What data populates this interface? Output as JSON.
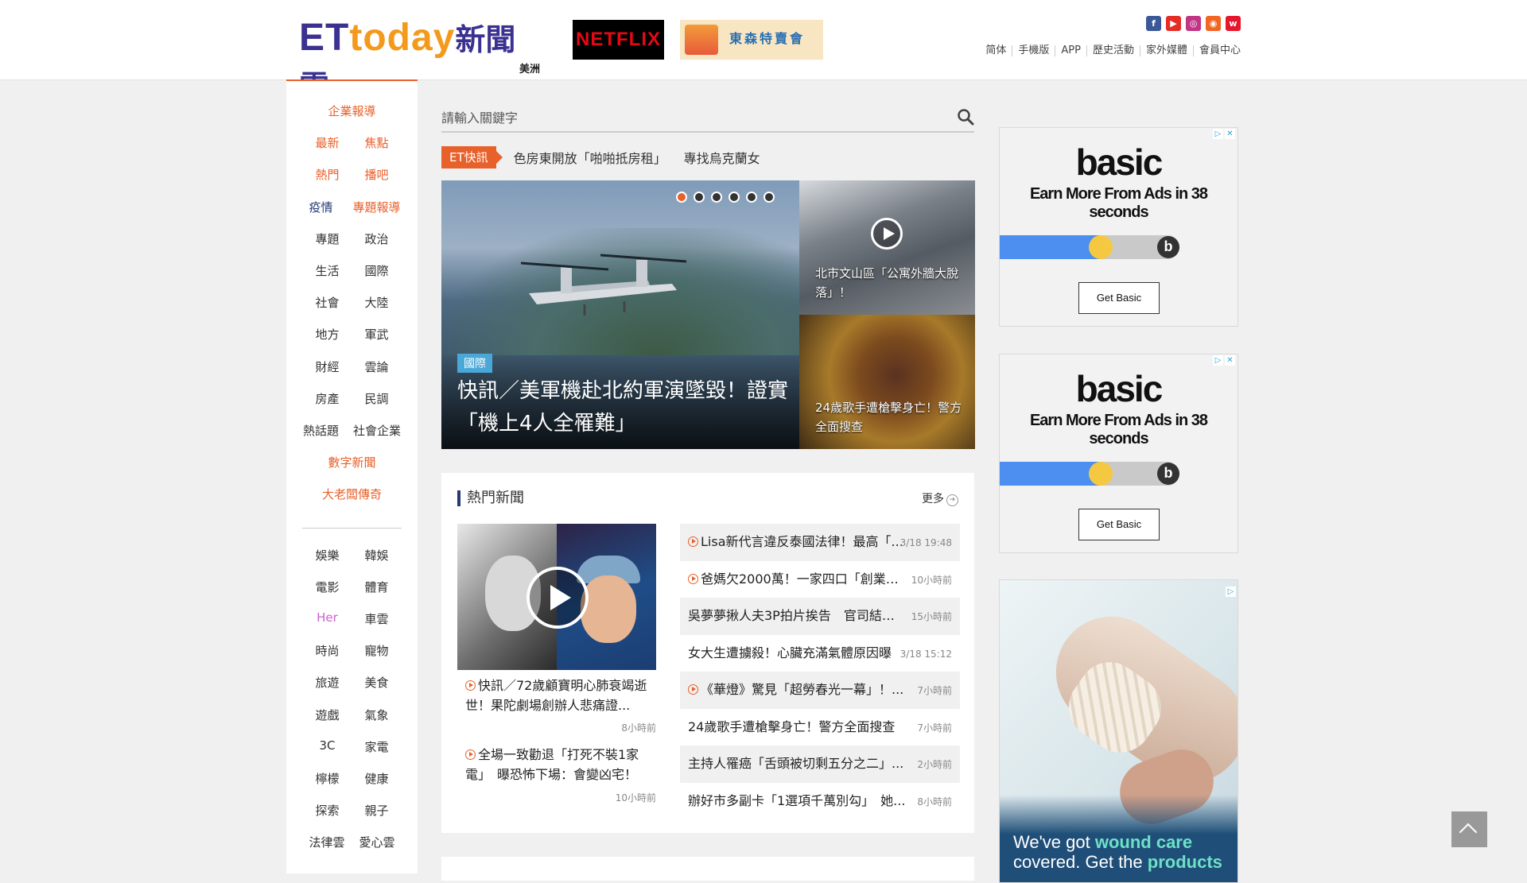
{
  "header": {
    "logo_text": "ETtoday新聞雲",
    "logo_region": "美洲",
    "netflix_label": "NETFLIX",
    "tosen_label": "東森特賣會",
    "social": [
      {
        "name": "facebook",
        "glyph": "f",
        "color": "#3b5998"
      },
      {
        "name": "youtube",
        "glyph": "▶",
        "color": "#e52d27"
      },
      {
        "name": "instagram",
        "glyph": "◎",
        "color": "#c13584"
      },
      {
        "name": "rss",
        "glyph": "◉",
        "color": "#f26522"
      },
      {
        "name": "weibo",
        "glyph": "w",
        "color": "#e6162d"
      }
    ],
    "links": [
      "简体",
      "手機版",
      "APP",
      "歷史活動",
      "家外媒體",
      "會員中心"
    ]
  },
  "sidebar": {
    "rows": [
      [
        {
          "label": "企業報導",
          "color": "orange"
        }
      ],
      [
        {
          "label": "最新",
          "color": "orange"
        },
        {
          "label": "焦點",
          "color": "orange"
        }
      ],
      [
        {
          "label": "熱門",
          "color": "orange"
        },
        {
          "label": "播吧",
          "color": "orange"
        }
      ],
      [
        {
          "label": "疫情",
          "color": "navy"
        },
        {
          "label": "專題報導",
          "color": "orange"
        }
      ],
      [
        {
          "label": "專題",
          "color": ""
        },
        {
          "label": "政治",
          "color": ""
        }
      ],
      [
        {
          "label": "生活",
          "color": ""
        },
        {
          "label": "國際",
          "color": ""
        }
      ],
      [
        {
          "label": "社會",
          "color": ""
        },
        {
          "label": "大陸",
          "color": ""
        }
      ],
      [
        {
          "label": "地方",
          "color": ""
        },
        {
          "label": "軍武",
          "color": ""
        }
      ],
      [
        {
          "label": "財經",
          "color": ""
        },
        {
          "label": "雲論",
          "color": ""
        }
      ],
      [
        {
          "label": "房產",
          "color": ""
        },
        {
          "label": "民調",
          "color": ""
        }
      ],
      [
        {
          "label": "熱話題",
          "color": ""
        },
        {
          "label": "社會企業",
          "color": ""
        }
      ],
      [
        {
          "label": "數字新聞",
          "color": "orange"
        }
      ],
      [
        {
          "label": "大老闆傳奇",
          "color": "orange"
        }
      ]
    ],
    "rows2": [
      [
        {
          "label": "娛樂",
          "color": ""
        },
        {
          "label": "韓娛",
          "color": ""
        }
      ],
      [
        {
          "label": "電影",
          "color": ""
        },
        {
          "label": "體育",
          "color": ""
        }
      ],
      [
        {
          "label": "Her",
          "color": "pink"
        },
        {
          "label": "車雲",
          "color": ""
        }
      ],
      [
        {
          "label": "時尚",
          "color": ""
        },
        {
          "label": "寵物",
          "color": ""
        }
      ],
      [
        {
          "label": "旅遊",
          "color": ""
        },
        {
          "label": "美食",
          "color": ""
        }
      ],
      [
        {
          "label": "遊戲",
          "color": ""
        },
        {
          "label": "氣象",
          "color": ""
        }
      ],
      [
        {
          "label": "3C",
          "color": ""
        },
        {
          "label": "家電",
          "color": ""
        }
      ],
      [
        {
          "label": "檸檬",
          "color": ""
        },
        {
          "label": "健康",
          "color": ""
        }
      ],
      [
        {
          "label": "探索",
          "color": ""
        },
        {
          "label": "親子",
          "color": ""
        }
      ],
      [
        {
          "label": "法律雲",
          "color": ""
        },
        {
          "label": "愛心雲",
          "color": ""
        }
      ]
    ]
  },
  "search": {
    "placeholder": "請輸入關鍵字"
  },
  "ticker": {
    "tag": "ET快訊",
    "items": [
      "色房東開放「啪啪抵房租」",
      "專找烏克蘭女"
    ]
  },
  "hero": {
    "category": "國際",
    "title": "快訊／美軍機赴北約軍演墜毀！證實「機上4人全罹難」",
    "slide_count": 6,
    "active_slide": 1,
    "side": [
      {
        "title": "北市文山區「公寓外牆大脫落」！",
        "video": true
      },
      {
        "title": "24歲歌手遭槍擊身亡！警方全面搜查",
        "video": false
      }
    ]
  },
  "hot_news": {
    "title": "熱門新聞",
    "more_label": "更多",
    "featured": [
      {
        "title": "快訊／72歲顧寶明心肺衰竭逝世！果陀劇場創辦人悲痛證...",
        "time": "8小時前",
        "video": true
      },
      {
        "title": "全場一致勸退「打死不裝1家電」　曝恐怖下場：會變凶宅！",
        "time": "10小時前",
        "video": true
      }
    ],
    "list": [
      {
        "title": "Lisa新代言違反泰國法律！最高「...",
        "time": "3/18 19:48",
        "video": true
      },
      {
        "title": "爸媽欠2000萬！一家四口「創業賣...",
        "time": "10小時前",
        "video": true
      },
      {
        "title": "吳夢夢揪人夫3P拍片挨告　官司結果...",
        "time": "15小時前",
        "video": false
      },
      {
        "title": "女大生遭擄殺！心臟充滿氣體原因曝",
        "time": "3/18 15:12",
        "video": false
      },
      {
        "title": "《華燈》驚見「超勞春光一幕」！...",
        "time": "7小時前",
        "video": true
      },
      {
        "title": "24歲歌手遭槍擊身亡！警方全面搜查",
        "time": "7小時前",
        "video": false
      },
      {
        "title": "主持人罹癌「舌頭被切剩五分之二」...",
        "time": "2小時前",
        "video": false
      },
      {
        "title": "辦好市多副卡「1選項千萬別勾」　她...",
        "time": "8小時前",
        "video": false
      }
    ]
  },
  "ads": [
    {
      "brand": "basic",
      "headline": "Earn More From Ads in 38 seconds",
      "button": "Get Basic",
      "progress": 0.5
    },
    {
      "brand": "basic",
      "headline": "Earn More From Ads in 38 seconds",
      "button": "Get Basic",
      "progress": 0.5
    },
    {
      "copy_before": "We've got ",
      "copy_highlight1": "wound care",
      "copy_mid": " covered. Get the ",
      "copy_highlight2": "products"
    }
  ],
  "colors": {
    "accent": "#e8602a",
    "navy": "#243a73",
    "pink": "#d05fd2"
  }
}
